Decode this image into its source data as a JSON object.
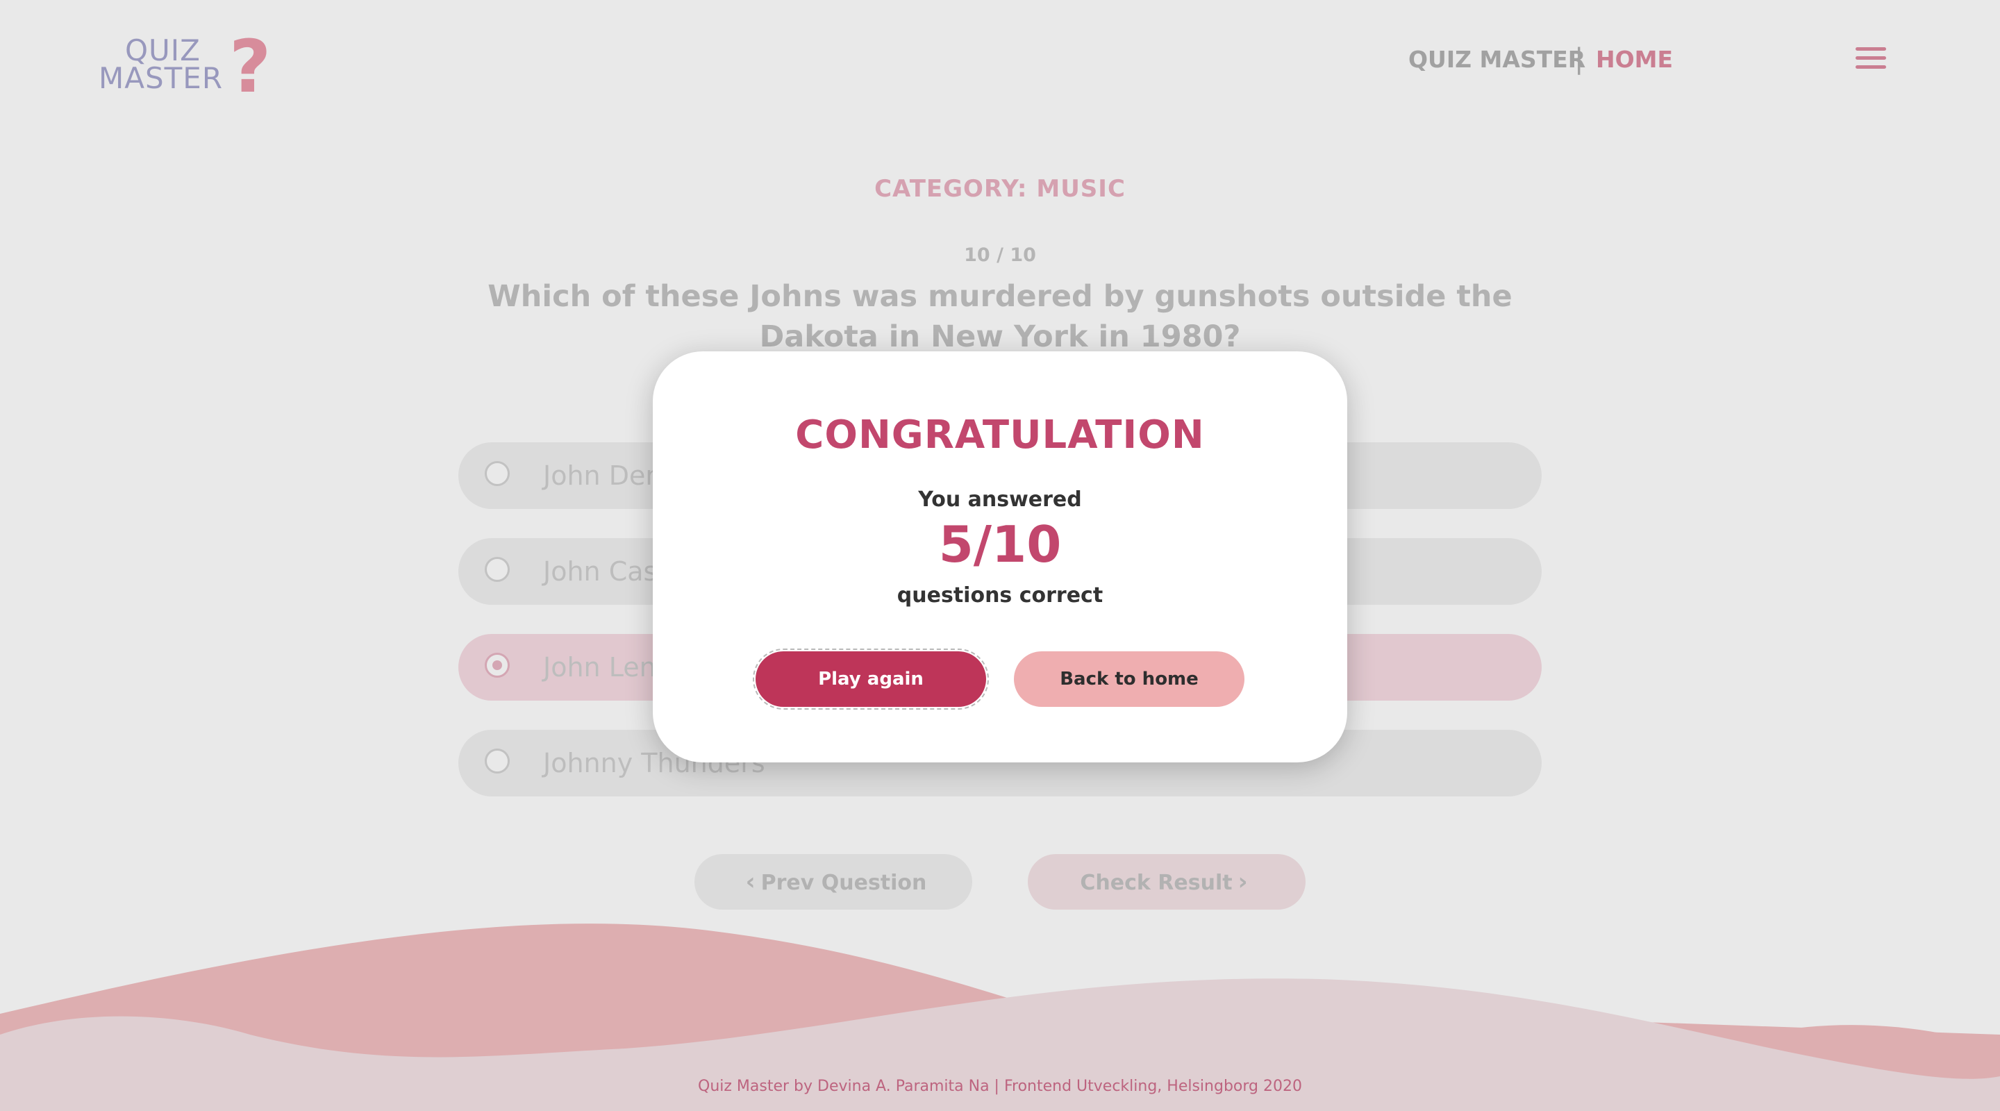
{
  "logo": {
    "line1": "QUIZ",
    "line2": "MASTER",
    "mark": "?"
  },
  "nav": {
    "title": "QUIZ MASTER",
    "separator": "|",
    "home": "HOME",
    "menu_icon": "hamburger-menu-icon"
  },
  "quiz": {
    "category": "CATEGORY: MUSIC",
    "counter": "10 / 10",
    "question": "Which of these Johns was murdered by gunshots outside the Dakota in New York in 1980?",
    "options": [
      {
        "label": "John Denver",
        "selected": false
      },
      {
        "label": "John Cash",
        "selected": false
      },
      {
        "label": "John Lennon",
        "selected": true
      },
      {
        "label": "Johnny Thunders",
        "selected": false
      }
    ],
    "prev_label": "Prev Question",
    "next_label": "Check Result"
  },
  "modal": {
    "title": "CONGRATULATION",
    "line1": "You answered",
    "score": "5/10",
    "line3": "questions correct",
    "play_again": "Play again",
    "back_home": "Back to home"
  },
  "footer": {
    "text": "Quiz Master by Devina A. Paramita Na | Frontend Utveckling, Helsingborg 2020"
  },
  "colors": {
    "accent": "#be3559",
    "accent_text": "#c2476d",
    "light_pink": "#efaeb0",
    "wave_front": "#f1dbe0",
    "wave_back": "#efaeb0"
  }
}
